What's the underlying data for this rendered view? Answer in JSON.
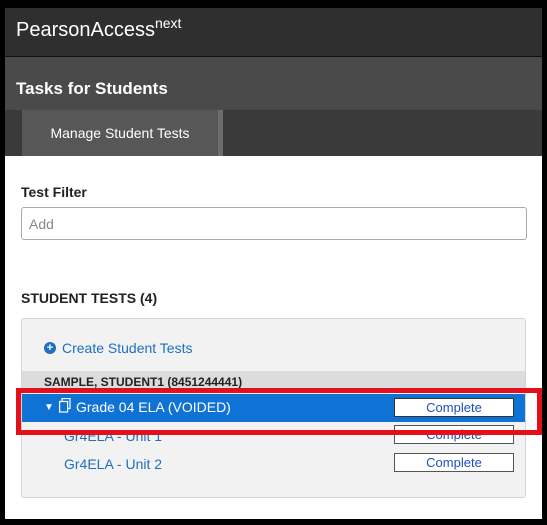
{
  "header": {
    "brand_main": "PearsonAccess",
    "brand_sup": "next"
  },
  "tasks": {
    "title": "Tasks for Students"
  },
  "tabs": [
    {
      "label": "Manage Student Tests",
      "active": true
    }
  ],
  "filter": {
    "label": "Test Filter",
    "placeholder": "Add",
    "value": ""
  },
  "student_tests": {
    "title": "STUDENT TESTS (4)",
    "create_label": "Create Student Tests",
    "student_label": "SAMPLE, STUDENT1 (8451244441)",
    "test": {
      "name": "Grade 04 ELA (VOIDED)",
      "status": "Complete",
      "expanded": true
    },
    "units": [
      {
        "name": "Gr4ELA - Unit 1",
        "status": "Complete"
      },
      {
        "name": "Gr4ELA - Unit 2",
        "status": "Complete"
      }
    ]
  },
  "colors": {
    "selected_row": "#0f73d6",
    "link": "#1f6fbf",
    "highlight": "#e3101c"
  }
}
